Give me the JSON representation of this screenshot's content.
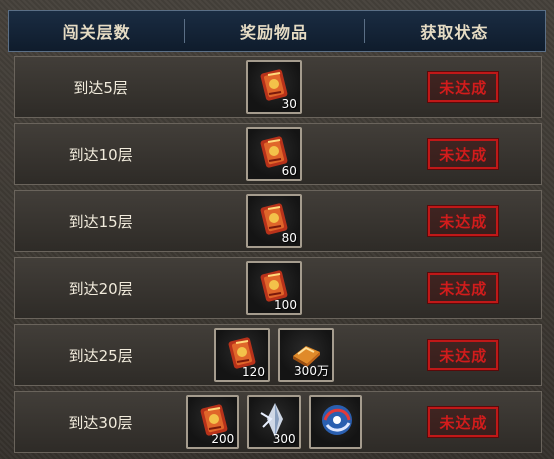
{
  "header": {
    "col_level": "闯关层数",
    "col_reward": "奖励物品",
    "col_status": "获取状态"
  },
  "rows": [
    {
      "level": "到达5层",
      "status": "未达成",
      "rewards": [
        {
          "icon": "red-scroll-icon",
          "qty": "30"
        }
      ]
    },
    {
      "level": "到达10层",
      "status": "未达成",
      "rewards": [
        {
          "icon": "red-scroll-icon",
          "qty": "60"
        }
      ]
    },
    {
      "level": "到达15层",
      "status": "未达成",
      "rewards": [
        {
          "icon": "red-scroll-icon",
          "qty": "80"
        }
      ]
    },
    {
      "level": "到达20层",
      "status": "未达成",
      "rewards": [
        {
          "icon": "red-scroll-icon",
          "qty": "100"
        }
      ]
    },
    {
      "level": "到达25层",
      "status": "未达成",
      "rewards": [
        {
          "icon": "red-scroll-icon",
          "qty": "120"
        },
        {
          "icon": "gold-ingot-icon",
          "qty": "300万"
        }
      ]
    },
    {
      "level": "到达30层",
      "status": "未达成",
      "rewards": [
        {
          "icon": "red-scroll-icon",
          "qty": "200"
        },
        {
          "icon": "crystal-shard-icon",
          "qty": "300"
        },
        {
          "icon": "swirl-orb-icon",
          "qty": ""
        }
      ]
    }
  ],
  "colors": {
    "status_red": "#d21c1c",
    "header_bg": "#13233a"
  }
}
